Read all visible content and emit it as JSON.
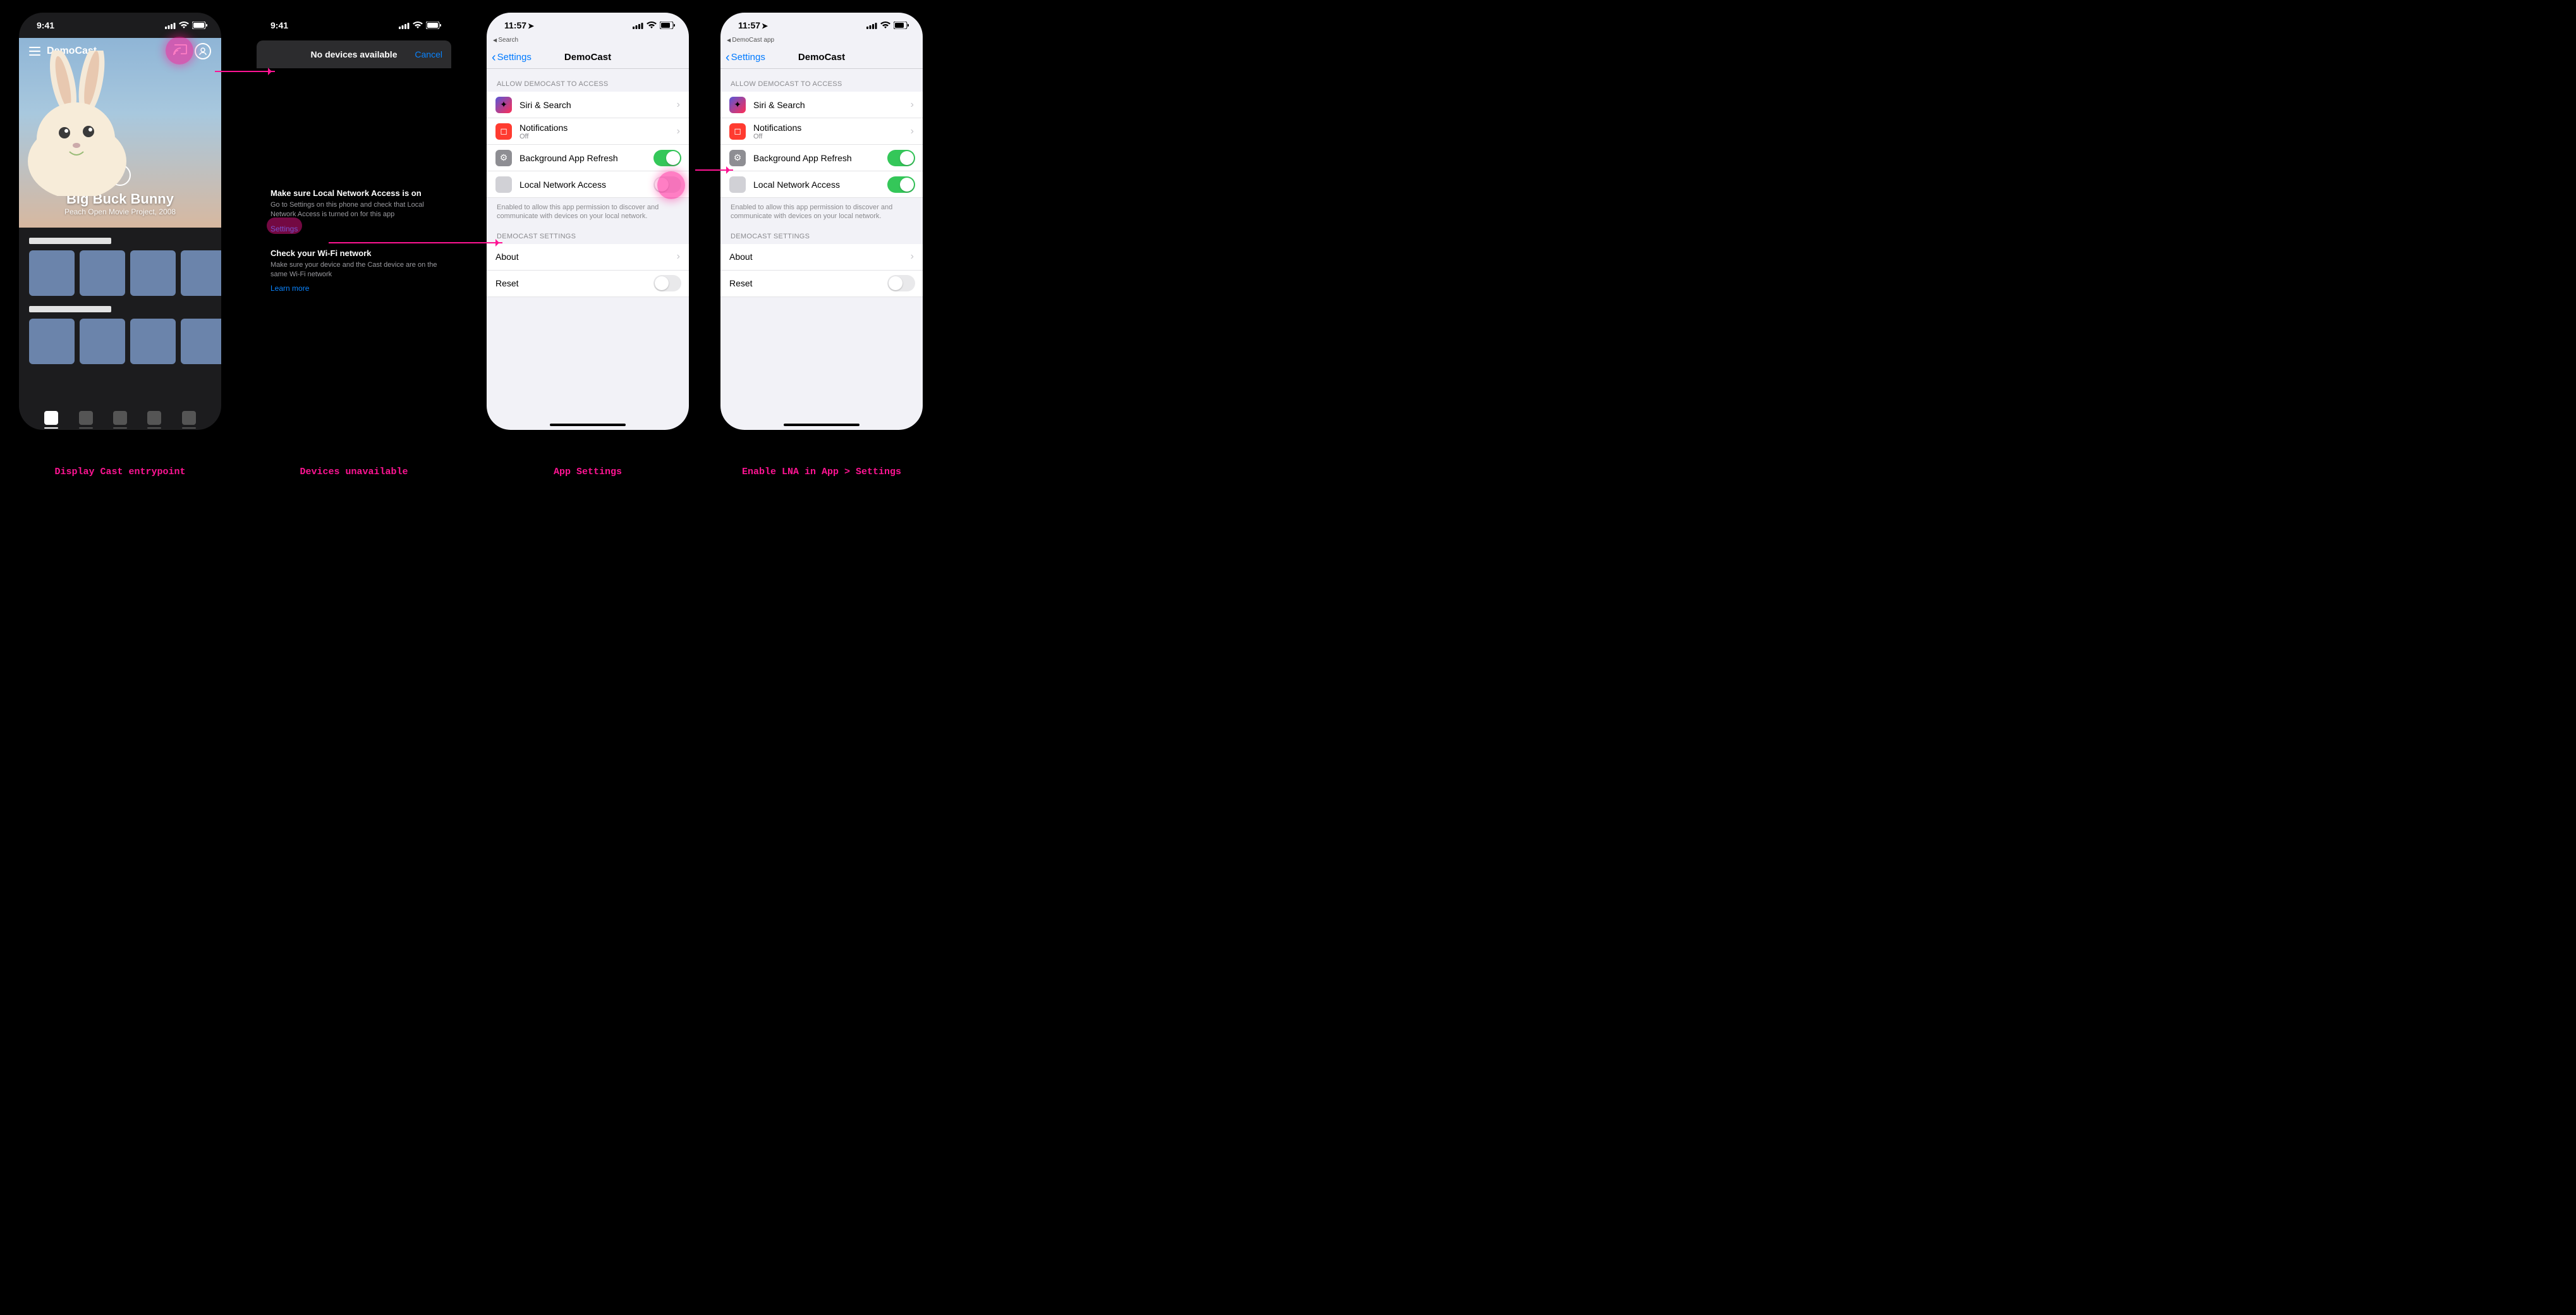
{
  "captions": {
    "s1": "Display Cast entrypoint",
    "s2": "Devices unavailable",
    "s3": "App Settings",
    "s4": "Enable LNA in App > Settings"
  },
  "s1": {
    "time": "9:41",
    "app_name": "DemoCast",
    "hero_title": "Big Buck Bunny",
    "hero_sub": "Peach Open Movie Project, 2008"
  },
  "s2": {
    "time": "9:41",
    "sheet_title": "No devices available",
    "cancel": "Cancel",
    "tip1_title": "Make sure Local Network Access is on",
    "tip1_body": "Go to Settings on this phone and check that Local Network Access is turned on for this app",
    "settings_link": "Settings",
    "tip2_title": "Check your Wi-Fi network",
    "tip2_body": "Make sure your device and the Cast device are on the same Wi-Fi network",
    "learn_more": "Learn more"
  },
  "s3": {
    "time": "11:57",
    "breadcrumb": "Search",
    "back": "Settings",
    "title": "DemoCast",
    "group_access": "ALLOW DEMOCAST TO ACCESS",
    "siri": "Siri & Search",
    "notif": "Notifications",
    "notif_sub": "Off",
    "bgrefresh": "Background App Refresh",
    "lna": "Local Network Access",
    "lna_footer": "Enabled to allow this app permission to discover and communicate with devices on your local network.",
    "group_app": "DEMOCAST SETTINGS",
    "about": "About",
    "reset": "Reset"
  },
  "s4": {
    "time": "11:57",
    "breadcrumb": "DemoCast app",
    "back": "Settings",
    "title": "DemoCast",
    "group_access": "ALLOW DEMOCAST TO ACCESS",
    "siri": "Siri & Search",
    "notif": "Notifications",
    "notif_sub": "Off",
    "bgrefresh": "Background App Refresh",
    "lna": "Local Network Access",
    "lna_footer": "Enabled to allow this app permission to discover and communicate with devices on your local network.",
    "group_app": "DEMOCAST SETTINGS",
    "about": "About",
    "reset": "Reset"
  }
}
